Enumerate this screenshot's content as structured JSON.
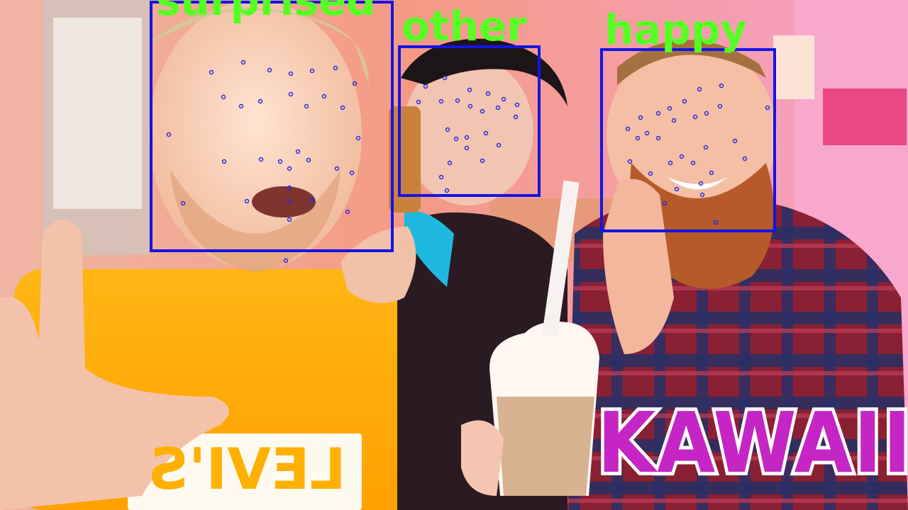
{
  "colors": {
    "face_box": "#1414e6",
    "landmark": "#2b2be0",
    "emotion_label": "#55ff22",
    "kawaii": "#c425c4",
    "kawaii_outline": "#ffffff"
  },
  "detections": [
    {
      "emotion": "surprised"
    },
    {
      "emotion": "other"
    },
    {
      "emotion": "happy"
    }
  ],
  "overlay_text": {
    "kawaii": "KAWAII",
    "shirt": "LEVI'S"
  }
}
